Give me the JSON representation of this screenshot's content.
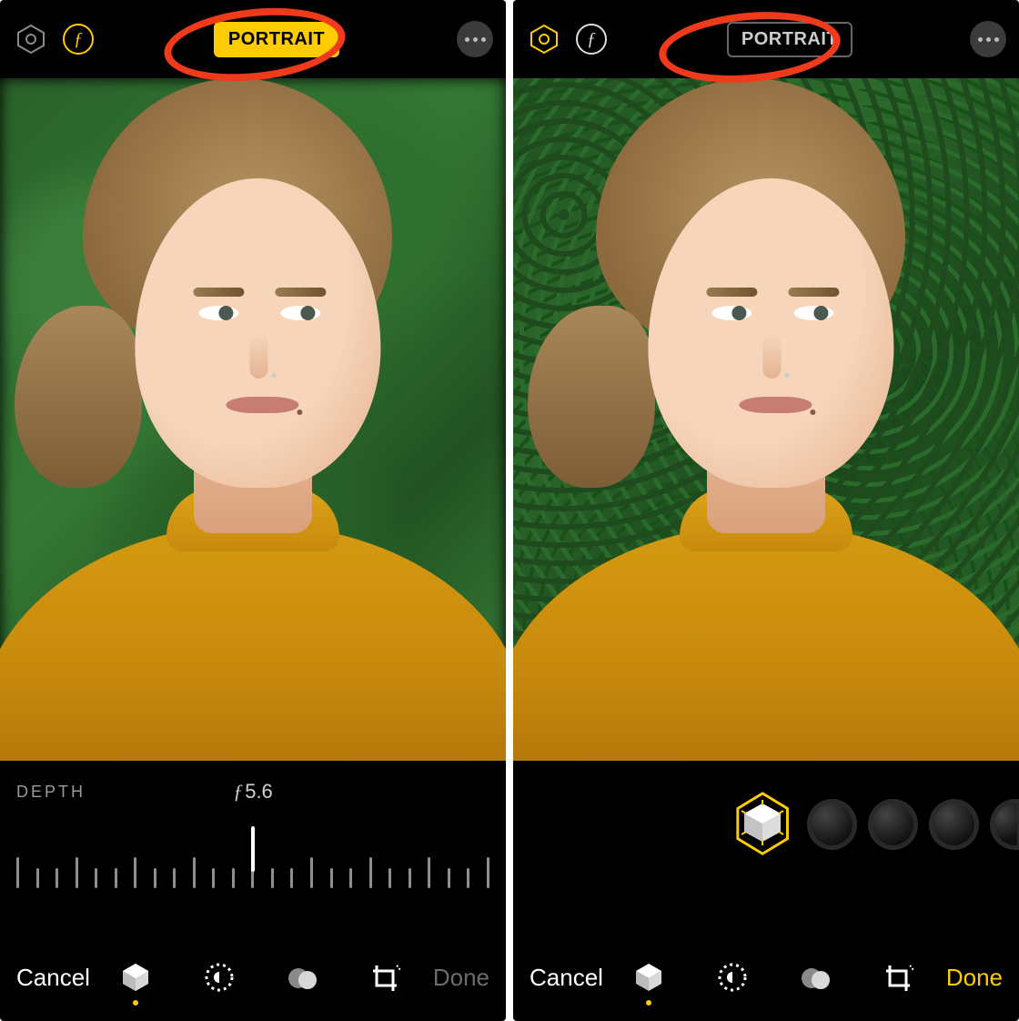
{
  "colors": {
    "accent": "#ffcc00",
    "annotation": "#ef3a1c"
  },
  "left": {
    "mode_label": "PORTRAIT",
    "portrait_active": true,
    "aperture_icon_active": true,
    "hex_icon_active": false,
    "depth": {
      "label": "DEPTH",
      "value": "5.6",
      "prefix": "ƒ"
    },
    "toolbar": {
      "cancel": "Cancel",
      "done": "Done",
      "done_enabled": false,
      "active_tab_index": 0
    },
    "tabs": [
      "portrait-tab",
      "adjust-tab",
      "filters-tab",
      "crop-tab"
    ]
  },
  "right": {
    "mode_label": "PORTRAIT",
    "portrait_active": false,
    "aperture_icon_active": false,
    "hex_icon_active": true,
    "lighting": {
      "selected": "natural-light",
      "options": [
        "studio-light",
        "contour-light",
        "stage-light",
        "stage-mono"
      ]
    },
    "toolbar": {
      "cancel": "Cancel",
      "done": "Done",
      "done_enabled": true,
      "active_tab_index": 0
    },
    "tabs": [
      "portrait-tab",
      "adjust-tab",
      "filters-tab",
      "crop-tab"
    ]
  }
}
